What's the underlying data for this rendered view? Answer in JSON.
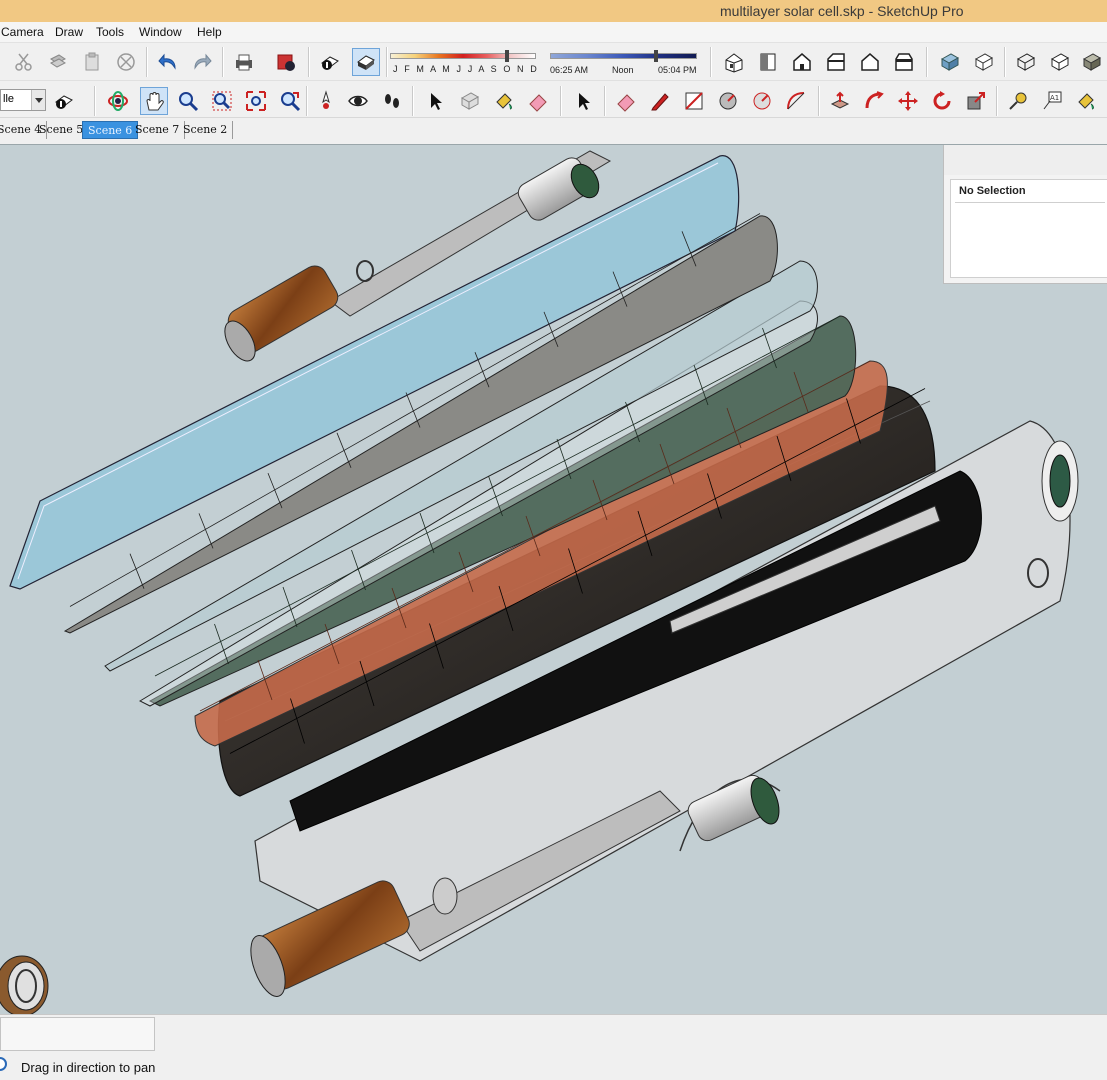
{
  "window": {
    "title": "multilayer solar cell.skp - SketchUp Pro"
  },
  "menu": {
    "items": [
      "Camera",
      "Draw",
      "Tools",
      "Window",
      "Help"
    ]
  },
  "toolbar1": {
    "buttons": [
      "cut-icon",
      "copy-icon",
      "paste-icon",
      "erase-icon",
      "undo-icon",
      "redo-icon",
      "print-icon",
      "model-info-icon",
      "display-shadows-icon",
      "display-fog-icon"
    ],
    "shadow_months": "J F M A M J J A S O N D",
    "shadow_month_position": 0.8,
    "time_start": "06:25 AM",
    "time_noon": "Noon",
    "time_end": "05:04 PM",
    "time_position": 0.72,
    "view_buttons": [
      "iso-view-icon",
      "top-view-icon",
      "front-view-icon",
      "right-view-icon",
      "back-view-icon",
      "left-view-icon"
    ],
    "style_buttons": [
      "xray-icon",
      "back-edges-icon",
      "wireframe-icon",
      "hidden-line-icon",
      "shaded-icon"
    ]
  },
  "toolbar2": {
    "style_select": "lle",
    "buttons": [
      "orbit-icon",
      "pan-icon",
      "zoom-icon",
      "zoom-window-icon",
      "zoom-extents-icon",
      "previous-view-icon",
      "position-camera-icon",
      "look-around-icon",
      "walk-icon",
      "select-icon",
      "make-component-icon",
      "paint-bucket-icon",
      "eraser-icon",
      "select-icon-2",
      "eraser-icon-2",
      "pencil-icon",
      "rectangle-icon",
      "circle-icon",
      "polygon-icon",
      "arc-icon",
      "push-pull-icon",
      "follow-me-icon",
      "move-icon",
      "rotate-icon",
      "scale-icon",
      "tape-measure-icon",
      "text-icon",
      "paint-icon"
    ],
    "active": "pan-icon"
  },
  "scenes": {
    "tabs": [
      "Scene 4",
      "Scene 5",
      "Scene 6",
      "Scene 7",
      "Scene 2"
    ],
    "active": "Scene 6"
  },
  "entity_info": {
    "label": "No Selection"
  },
  "status": {
    "text": "Drag in direction to pan",
    "measurements_value": ""
  },
  "colors": {
    "viewport_bg": "#c3cfd3",
    "glass": "#9bc7d8",
    "gray_layer": "#8a8a86",
    "green_layer": "#4e6758",
    "copper_layer": "#c56a4a",
    "dark_layer": "#3d3a36",
    "wood": "#8b4a1e"
  }
}
